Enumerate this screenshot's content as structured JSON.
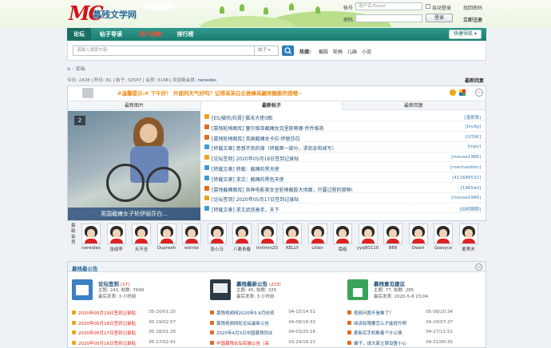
{
  "header": {
    "logo_mark": "MC",
    "logo_name": "慕残文学网",
    "login": {
      "account_label": "帐号",
      "account_placeholder": "用户名/Email",
      "password_label": "密码",
      "autologin_label": "自动登录",
      "find_password": "找回密码",
      "login_button": "登录",
      "register_button": "立即注册"
    }
  },
  "nav": {
    "items": [
      {
        "label": "论坛"
      },
      {
        "label": "帖子导读"
      },
      {
        "label": "用户投稿"
      },
      {
        "label": "排行榜"
      }
    ],
    "quick_nav": "快捷导航"
  },
  "search": {
    "placeholder": "请输入搜索内容",
    "type": "帖子",
    "hot_label": "热搜:",
    "hot_terms": [
      "截肢",
      "轮椅",
      "儿麻",
      "小说"
    ]
  },
  "breadcrumb": {
    "current": "论坛"
  },
  "stats": {
    "today_label": "今日:",
    "today": "2428",
    "yesterday_label": "昨日:",
    "yesterday": "81",
    "posts_label": "帖子:",
    "posts": "32547",
    "members_label": "会员:",
    "members": "3148",
    "welcome_label": "欢迎新会员:",
    "new_member": "nereides",
    "latest_reply": "最新回复"
  },
  "notice": "#温馨提示:# 下午好！ 外面的天气好吗？记得采采白云尝蜂采翩来酸膨的我哦~",
  "tabs": [
    "最新图片",
    "最新帖子",
    "最新回复"
  ],
  "photo": {
    "number": "2",
    "caption": "英国截瘫女子轮伊丽莎白..."
  },
  "posts": [
    {
      "title": "[ES/描帘/石膏] 脑末大佬0图",
      "author": "[漫爱情]"
    },
    {
      "title": "[慕残轮椅图库] 塞尔维亚截瘫女克里斯蒂娜·乔乔维奇",
      "author": "[Iovdg]"
    },
    {
      "title": "[慕残轮椅图库] 英国截瘫女卡拉·伊丽莎白",
      "author": "[LYSW]"
    },
    {
      "title": "[转载文章] 意想不到的缘（转载第一部分，求剑余和续写）",
      "author": "[mpo]"
    },
    {
      "title": "[论坛签到] 2020年05月18日签到记录贴",
      "author": "[mouse1986]"
    },
    {
      "title": "[转载文章] 转载：截瘫的黑天使",
      "author": "[mermaidren]"
    },
    {
      "title": "[转载文章] 求文：截瘫的黑色天使",
      "author": "[411686532]"
    },
    {
      "title": "[慕残截瘫图库] 各种电影美女坐轮椅截肢大场面，只要过程的那种!",
      "author": "[1965dd]"
    },
    {
      "title": "[论坛签到] 2020年05月17日签到记录贴",
      "author": "[mouse1986]"
    },
    {
      "title": "[转载文章] 求文武侠高手，天下",
      "author": "[旧桥颐颐]"
    }
  ],
  "members_label": "最新会员",
  "members": [
    "nereides",
    "张成李",
    "天不全",
    "Dupreeh",
    "winnie",
    "张小马",
    "八离青春",
    "linlimin20",
    "KELLY",
    "Lilian",
    "南组",
    "yyq80110",
    "888",
    "Owari",
    "Giaoyce",
    "麦蒂夫"
  ],
  "announce": {
    "title": "慕残最公告",
    "forums": [
      {
        "name": "论坛签到",
        "count": "(17)",
        "topics_label": "主题:",
        "topics": "243",
        "posts_label": "帖数:",
        "posts": "7699",
        "last_label": "最后发表:",
        "last": "3 小时前"
      },
      {
        "name": "慕残最新公告",
        "count": "(213)",
        "topics_label": "主题:",
        "topics": "45",
        "posts_label": "帖数:",
        "posts": "325",
        "last_label": "最后发表:",
        "last": "3 小时前"
      },
      {
        "name": "慕残意见建议",
        "count": "",
        "topics_label": "主题:",
        "topics": "77",
        "posts_label": "帖数:",
        "posts": "285",
        "last_label": "最后发表:",
        "last": "2020-5-8 23:04"
      }
    ],
    "col1": [
      {
        "title": "2020年05月19日签到记录贴",
        "date": "05-20/01:25"
      },
      {
        "title": "2020年05月18日签到记录贴",
        "date": "05-19/02:57"
      },
      {
        "title": "2020年05月17日签到记录贴",
        "date": "05-18/01:26"
      },
      {
        "title": "2020年05月16日签到记录贴",
        "date": "05-17/02:41"
      }
    ],
    "col2": [
      {
        "title": "慕残视频网2020年5-6月份将",
        "date": "04-15/14:51"
      },
      {
        "title": "慕残视频网轮论坛最新公告",
        "date": "04-08/18:33"
      },
      {
        "title": "2020年4月3日中国慕残同业",
        "date": "04-03/20:16"
      },
      {
        "title": "中国慕残论坛实施公告（采",
        "date": "03-24/18:23"
      }
    ],
    "col3": [
      {
        "title": "视频问题不是推了？",
        "date": "05-08/20:34"
      },
      {
        "title": "阅读权限要怎么才能提升啊",
        "date": "04-29/07:37"
      },
      {
        "title": "更新后手机断着个什么情",
        "date": "04-27/11:52"
      },
      {
        "title": "儡子，请大家立铸设置小心",
        "date": "04-21/00:35"
      }
    ]
  },
  "colors": {
    "nav_green": "#1c7d71",
    "link_blue": "#1e4e78",
    "accent_red": "#e0261b",
    "notice_orange": "#e98a14"
  }
}
